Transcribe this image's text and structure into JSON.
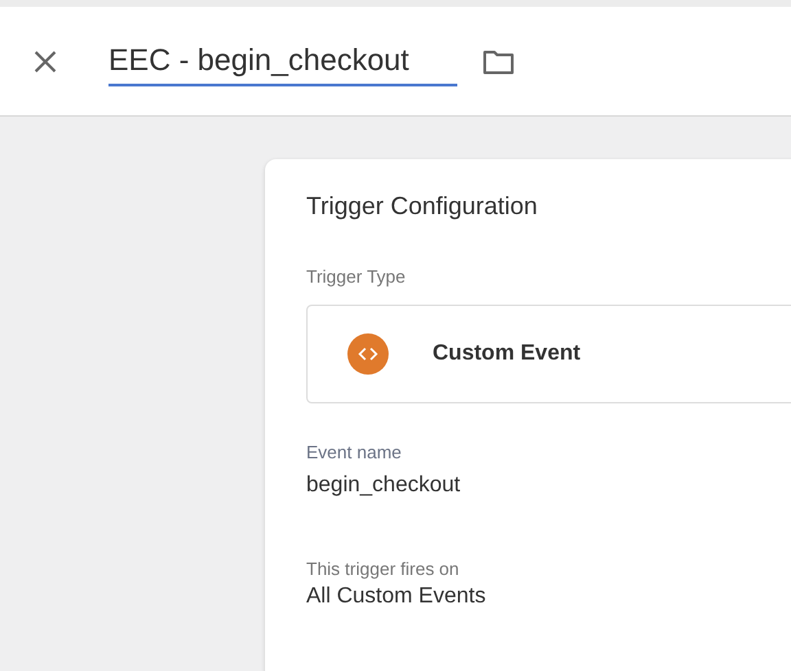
{
  "header": {
    "name_value": "EEC - begin_checkout"
  },
  "trigger_configuration": {
    "title": "Trigger Configuration",
    "type_label": "Trigger Type",
    "type_name": "Custom Event",
    "event_name_label": "Event name",
    "event_name": "begin_checkout",
    "fires_on_label": "This trigger fires on",
    "fires_on": "All Custom Events"
  }
}
